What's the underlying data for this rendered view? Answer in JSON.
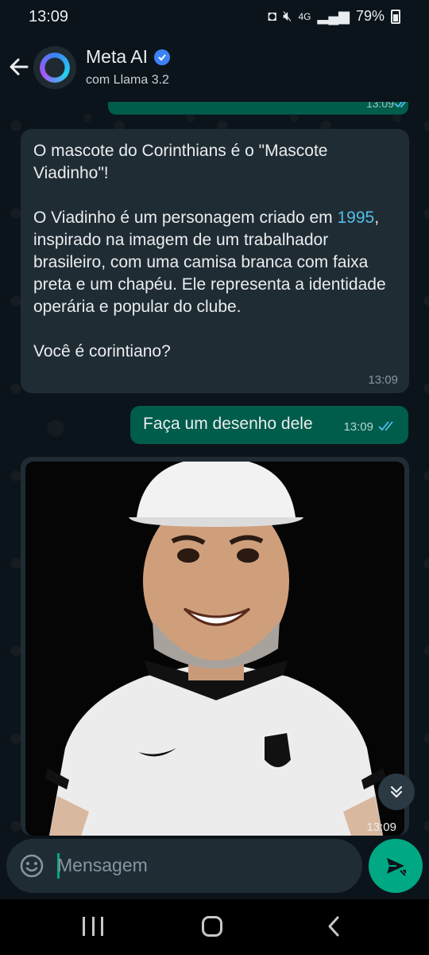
{
  "status_bar": {
    "time": "13:09",
    "network": "4G",
    "battery": "79%"
  },
  "header": {
    "contact_name": "Meta AI",
    "subtitle": "com Llama 3.2",
    "accent_color": "#3b82f6"
  },
  "messages": {
    "partial_out": {
      "time": "13:09"
    },
    "incoming": {
      "text_before_link": "O mascote do Corinthians é o \"Mascote Viadinho\"!\n\nO Viadinho é um personagem criado em ",
      "link": "1995",
      "text_after_link": ", inspirado na imagem de um trabalhador brasileiro, com uma camisa branca com faixa preta e um chapéu. Ele representa a identidade operária e popular do clube.\n\nVocê é corintiano?",
      "time": "13:09"
    },
    "outgoing": {
      "text": "Faça um desenho dele",
      "time": "13:09"
    },
    "image": {
      "time": "13:09"
    }
  },
  "input": {
    "placeholder": "Mensagem"
  },
  "icons": {
    "back": "arrow-left-icon",
    "verified": "verified-badge-icon",
    "emoji": "emoji-icon",
    "send": "send-icon",
    "scroll_down": "double-chevron-down-icon"
  },
  "colors": {
    "background": "#0b141a",
    "incoming_bubble": "#202c33",
    "outgoing_bubble": "#005c4b",
    "send_button": "#00a884",
    "link": "#53bdeb",
    "read_ticks": "#53bdeb"
  }
}
